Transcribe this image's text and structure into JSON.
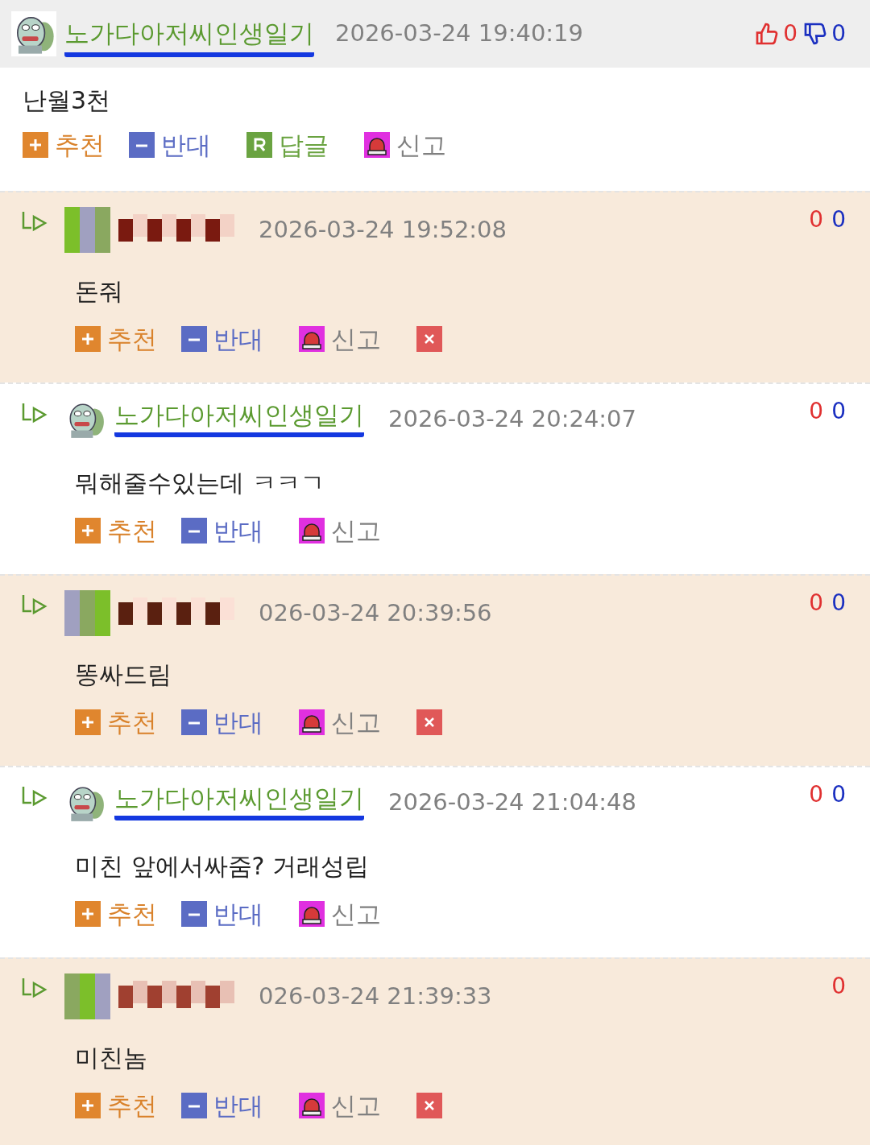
{
  "comments": [
    {
      "kind": "post",
      "author": {
        "kind": "named",
        "name": "노가다아저씨인생일기",
        "underlined": true
      },
      "time": "2026-03-24 19:40:19",
      "likes": "0",
      "dislikes": "0",
      "text": "난월3천",
      "actions": [
        {
          "kind": "recommend",
          "label": "추천"
        },
        {
          "kind": "oppose",
          "label": "반대"
        },
        {
          "kind": "reply",
          "label": "답글"
        },
        {
          "kind": "report",
          "label": "신고"
        }
      ]
    },
    {
      "kind": "reply",
      "author": {
        "kind": "hidden"
      },
      "time": "2026-03-24 19:52:08",
      "likes": "0",
      "dislikes": "0",
      "text": "돈줘",
      "actions": [
        {
          "kind": "recommend",
          "label": "추천"
        },
        {
          "kind": "oppose",
          "label": "반대"
        },
        {
          "kind": "report",
          "label": "신고"
        },
        {
          "kind": "delete"
        }
      ]
    },
    {
      "kind": "reply",
      "author": {
        "kind": "named",
        "name": "노가다아저씨인생일기",
        "underlined": true
      },
      "time": "2026-03-24 20:24:07",
      "likes": "0",
      "dislikes": "0",
      "text": "뭐해줄수있는데 ㅋㅋㄱ",
      "actions": [
        {
          "kind": "recommend",
          "label": "추천"
        },
        {
          "kind": "oppose",
          "label": "반대"
        },
        {
          "kind": "report",
          "label": "신고"
        }
      ]
    },
    {
      "kind": "reply",
      "author": {
        "kind": "hidden"
      },
      "time": "026-03-24 20:39:56",
      "likes": "0",
      "dislikes": "0",
      "text": "똥싸드림",
      "actions": [
        {
          "kind": "recommend",
          "label": "추천"
        },
        {
          "kind": "oppose",
          "label": "반대"
        },
        {
          "kind": "report",
          "label": "신고"
        },
        {
          "kind": "delete"
        }
      ]
    },
    {
      "kind": "reply",
      "author": {
        "kind": "named",
        "name": "노가다아저씨인생일기",
        "underlined": true
      },
      "time": "2026-03-24 21:04:48",
      "likes": "0",
      "dislikes": "0",
      "text": "미친 앞에서싸줌? 거래성립",
      "actions": [
        {
          "kind": "recommend",
          "label": "추천"
        },
        {
          "kind": "oppose",
          "label": "반대"
        },
        {
          "kind": "report",
          "label": "신고"
        }
      ]
    },
    {
      "kind": "reply",
      "author": {
        "kind": "hidden"
      },
      "time": "026-03-24 21:39:33",
      "likes": "0",
      "text": "미친놈",
      "actions": [
        {
          "kind": "recommend",
          "label": "추천"
        },
        {
          "kind": "oppose",
          "label": "반대"
        },
        {
          "kind": "report",
          "label": "신고"
        },
        {
          "kind": "delete"
        }
      ]
    }
  ]
}
